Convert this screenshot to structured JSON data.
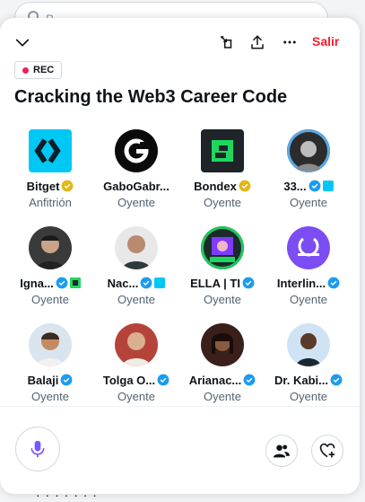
{
  "background": {
    "search_placeholder": "B",
    "bottom_text": "· · · · · · ·"
  },
  "header": {
    "exit_label": "Salir"
  },
  "space": {
    "rec_label": "REC",
    "title": "Cracking the Web3 Career Code"
  },
  "participants": [
    {
      "name": "Bitget",
      "role": "Anfitrión",
      "badge": "gold"
    },
    {
      "name": "GaboGabr...",
      "role": "Oyente",
      "badge": "none"
    },
    {
      "name": "Bondex",
      "role": "Oyente",
      "badge": "gold"
    },
    {
      "name": "33...",
      "role": "Oyente",
      "badge": "blue"
    },
    {
      "name": "Igna...",
      "role": "Oyente",
      "badge": "blue"
    },
    {
      "name": "Nac...",
      "role": "Oyente",
      "badge": "blue"
    },
    {
      "name": "ELLA | TI",
      "role": "Oyente",
      "badge": "blue"
    },
    {
      "name": "Interlin...",
      "role": "Oyente",
      "badge": "blue"
    },
    {
      "name": "Balaji",
      "role": "Oyente",
      "badge": "blue"
    },
    {
      "name": "Tolga O...",
      "role": "Oyente",
      "badge": "blue"
    },
    {
      "name": "Arianac...",
      "role": "Oyente",
      "badge": "blue"
    },
    {
      "name": "Dr. Kabi...",
      "role": "Oyente",
      "badge": "blue"
    }
  ],
  "colors": {
    "exit": "#f4212e",
    "verified_blue": "#1d9bf0",
    "verified_gold": "#e2b719",
    "mic": "#7856ff"
  }
}
